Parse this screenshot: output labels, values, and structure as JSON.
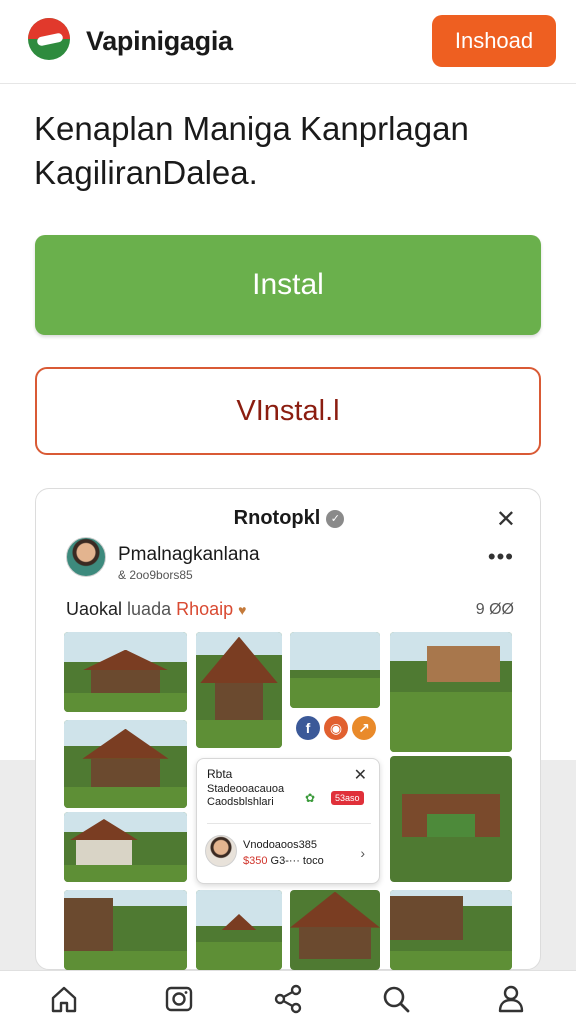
{
  "header": {
    "app_name": "Vapinigagia",
    "top_button": "Inshoad",
    "logo_icon": "brand-logo-icon"
  },
  "headline": "Kenaplan Maniga Kanprlagan KagiliranDalea.",
  "buttons": {
    "install": "Instal",
    "uninstall": "VInstal.l"
  },
  "post": {
    "title": "Rnotopkl",
    "author": "Pmalnagkanlana",
    "author_sub": "& 2oo9bors85",
    "caption_prefix": "Uaokal",
    "caption_mid": "luada",
    "caption_place": "Rhoaip",
    "likes": "9 ØØ"
  },
  "popup": {
    "title": "Rbta",
    "line1": "Stadeooacauoa",
    "line2": "Caodsblshlari",
    "badge": "53aso",
    "name": "Vnodoaoos385",
    "price_red": "$350",
    "price_rest": "G3-··· toco"
  },
  "social": [
    "facebook-icon",
    "instagram-icon",
    "share-icon"
  ],
  "nav": [
    "home-icon",
    "camera-icon",
    "share-icon",
    "search-icon",
    "profile-icon"
  ],
  "colors": {
    "accent_orange": "#ee5f21",
    "install_green": "#6ab04c",
    "uninstall_border": "#d95a35"
  }
}
